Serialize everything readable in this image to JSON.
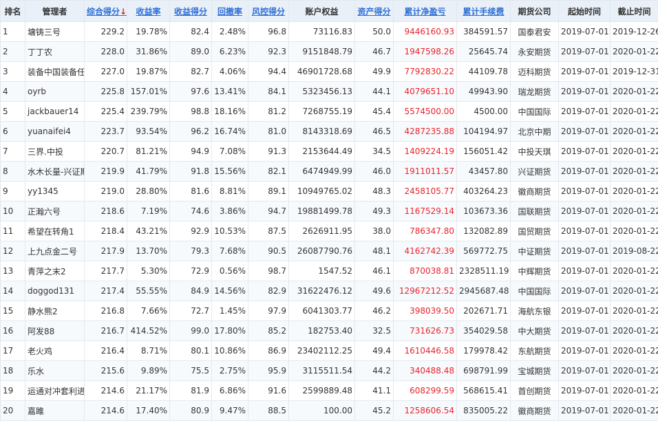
{
  "columns": [
    {
      "label": "排名",
      "sortable": false
    },
    {
      "label": "管理者",
      "sortable": false
    },
    {
      "label": "综合得分",
      "sortable": true,
      "sorted": true,
      "arrow": "↓"
    },
    {
      "label": "收益率",
      "sortable": true
    },
    {
      "label": "收益得分",
      "sortable": true
    },
    {
      "label": "回撤率",
      "sortable": true
    },
    {
      "label": "风控得分",
      "sortable": true
    },
    {
      "label": "账户权益",
      "sortable": false
    },
    {
      "label": "资产得分",
      "sortable": true
    },
    {
      "label": "累计净盈亏",
      "sortable": true
    },
    {
      "label": "累计手续费",
      "sortable": true
    },
    {
      "label": "期货公司",
      "sortable": false
    },
    {
      "label": "起始时间",
      "sortable": false
    },
    {
      "label": "截止时间",
      "sortable": false
    }
  ],
  "rows": [
    [
      "1",
      "墉铸三号",
      "229.2",
      "19.78%",
      "82.4",
      "2.48%",
      "96.8",
      "73116.83",
      "50.0",
      "9446160.93",
      "384591.57",
      "国泰君安",
      "2019-07-01",
      "2019-12-26"
    ],
    [
      "2",
      "丁丁农",
      "228.0",
      "31.86%",
      "89.0",
      "6.23%",
      "92.3",
      "9151848.79",
      "46.7",
      "1947598.26",
      "25645.74",
      "永安期货",
      "2019-07-01",
      "2020-01-22"
    ],
    [
      "3",
      "装备中国装备任",
      "227.0",
      "19.87%",
      "82.7",
      "4.06%",
      "94.4",
      "46901728.68",
      "49.9",
      "7792830.22",
      "44109.78",
      "迈科期货",
      "2019-07-01",
      "2019-12-31"
    ],
    [
      "4",
      "oyrb",
      "225.8",
      "157.01%",
      "97.6",
      "13.41%",
      "84.1",
      "5323456.13",
      "44.1",
      "4079651.10",
      "49943.90",
      "瑞龙期货",
      "2019-07-01",
      "2020-01-22"
    ],
    [
      "5",
      "jackbauer14",
      "225.4",
      "239.79%",
      "98.8",
      "18.16%",
      "81.2",
      "7268755.19",
      "45.4",
      "5574500.00",
      "4500.00",
      "中国国际",
      "2019-07-01",
      "2020-01-22"
    ],
    [
      "6",
      "yuanaifei4",
      "223.7",
      "93.54%",
      "96.2",
      "16.74%",
      "81.0",
      "8143318.69",
      "46.5",
      "4287235.88",
      "104194.97",
      "北京中期",
      "2019-07-01",
      "2020-01-22"
    ],
    [
      "7",
      "三界.中投",
      "220.7",
      "81.21%",
      "94.9",
      "7.08%",
      "91.3",
      "2153644.49",
      "34.5",
      "1409224.19",
      "156051.42",
      "中投天琪",
      "2019-07-01",
      "2020-01-22"
    ],
    [
      "8",
      "水木长量-兴证期",
      "219.9",
      "41.79%",
      "91.8",
      "15.56%",
      "82.1",
      "6474949.99",
      "46.0",
      "1911011.57",
      "43457.80",
      "兴证期货",
      "2019-07-01",
      "2020-01-22"
    ],
    [
      "9",
      "yy1345",
      "219.0",
      "28.80%",
      "81.6",
      "8.81%",
      "89.1",
      "10949765.02",
      "48.3",
      "2458105.77",
      "403264.23",
      "徽商期货",
      "2019-07-01",
      "2020-01-22"
    ],
    [
      "10",
      "正瀚六号",
      "218.6",
      "7.19%",
      "74.6",
      "3.86%",
      "94.7",
      "19881499.78",
      "49.3",
      "1167529.14",
      "103673.36",
      "国联期货",
      "2019-07-01",
      "2020-01-22"
    ],
    [
      "11",
      "希望在转角1",
      "218.4",
      "43.21%",
      "92.9",
      "10.53%",
      "87.5",
      "2626911.95",
      "38.0",
      "786347.80",
      "132082.89",
      "国贸期货",
      "2019-07-01",
      "2020-01-22"
    ],
    [
      "12",
      "上九点金二号",
      "217.9",
      "13.70%",
      "79.3",
      "7.68%",
      "90.5",
      "26087790.76",
      "48.1",
      "4162742.39",
      "569772.75",
      "中证期货",
      "2019-07-01",
      "2019-08-22"
    ],
    [
      "13",
      "青萍之末2",
      "217.7",
      "5.30%",
      "72.9",
      "0.56%",
      "98.7",
      "1547.52",
      "46.1",
      "870038.81",
      "2328511.19",
      "中辉期货",
      "2019-07-01",
      "2020-01-22"
    ],
    [
      "14",
      "doggod131",
      "217.4",
      "55.55%",
      "84.9",
      "14.56%",
      "82.9",
      "31622476.12",
      "49.6",
      "12967212.52",
      "2945687.48",
      "中国国际",
      "2019-07-01",
      "2020-01-22"
    ],
    [
      "15",
      "静水熊2",
      "216.8",
      "7.66%",
      "72.7",
      "1.45%",
      "97.9",
      "6041303.77",
      "46.2",
      "398039.50",
      "202671.71",
      "海航东银",
      "2019-07-01",
      "2020-01-22"
    ],
    [
      "16",
      "阿发88",
      "216.7",
      "414.52%",
      "99.0",
      "17.80%",
      "85.2",
      "182753.40",
      "32.5",
      "731626.73",
      "354029.58",
      "中大期货",
      "2019-07-01",
      "2020-01-22"
    ],
    [
      "17",
      "老火鸡",
      "216.4",
      "8.71%",
      "80.1",
      "10.86%",
      "86.9",
      "23402112.25",
      "49.4",
      "1610446.58",
      "179978.42",
      "东航期货",
      "2019-07-01",
      "2020-01-22"
    ],
    [
      "18",
      "乐水",
      "215.6",
      "9.89%",
      "75.5",
      "2.75%",
      "95.9",
      "3115511.54",
      "44.2",
      "340488.48",
      "698791.99",
      "宝城期货",
      "2019-07-01",
      "2020-01-22"
    ],
    [
      "19",
      "运通对冲套利进",
      "214.6",
      "21.17%",
      "81.9",
      "6.86%",
      "91.6",
      "2599889.48",
      "41.1",
      "608299.59",
      "568615.41",
      "首创期货",
      "2019-07-01",
      "2020-01-22"
    ],
    [
      "20",
      "嘉雎",
      "214.6",
      "17.40%",
      "80.9",
      "9.47%",
      "88.5",
      "100.00",
      "45.2",
      "1258606.54",
      "835005.22",
      "徽商期货",
      "2019-07-01",
      "2020-01-22"
    ]
  ],
  "colors": {
    "header_bg": "#e9f0f8",
    "link": "#2f6fd6",
    "profit": "#e8232a",
    "sort_arrow": "#e02020"
  }
}
